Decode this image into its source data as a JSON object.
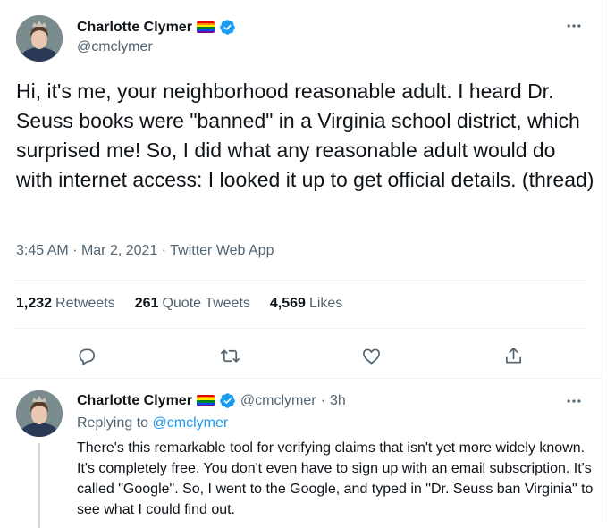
{
  "tweet": {
    "author": {
      "display_name": "Charlotte Clymer",
      "handle": "@cmclymer",
      "flag_emoji": "rainbow-flag-icon",
      "verified": true
    },
    "text": "Hi, it's me, your neighborhood reasonable adult. I heard Dr. Seuss books were \"banned\" in a Virginia school district, which surprised me! So, I did what any reasonable adult would do with internet access: I looked it up to get official details. (thread)",
    "time": "3:45 AM",
    "date": "Mar 2, 2021",
    "source": "Twitter Web App",
    "separator": "·",
    "stats": {
      "retweets_count": "1,232",
      "retweets_label": "Retweets",
      "quote_count": "261",
      "quote_label": "Quote Tweets",
      "likes_count": "4,569",
      "likes_label": "Likes"
    },
    "actions": [
      "reply-icon",
      "retweet-icon",
      "like-icon",
      "share-icon"
    ]
  },
  "reply": {
    "author": {
      "display_name": "Charlotte Clymer",
      "handle": "@cmclymer",
      "age": "3h"
    },
    "replying_prefix": "Replying to",
    "replying_to": "@cmclymer",
    "text": "There's this remarkable tool for verifying claims that isn't yet more widely known. It's completely free. You don't even have to sign up with an email subscription. It's called \"Google\". So, I went to the Google, and typed in \"Dr. Seuss ban Virginia\" to see what I could find out."
  },
  "colors": {
    "accent": "#1d9bf0",
    "text_primary": "#0f1419",
    "text_secondary": "#536471",
    "divider": "#eff3f4"
  }
}
